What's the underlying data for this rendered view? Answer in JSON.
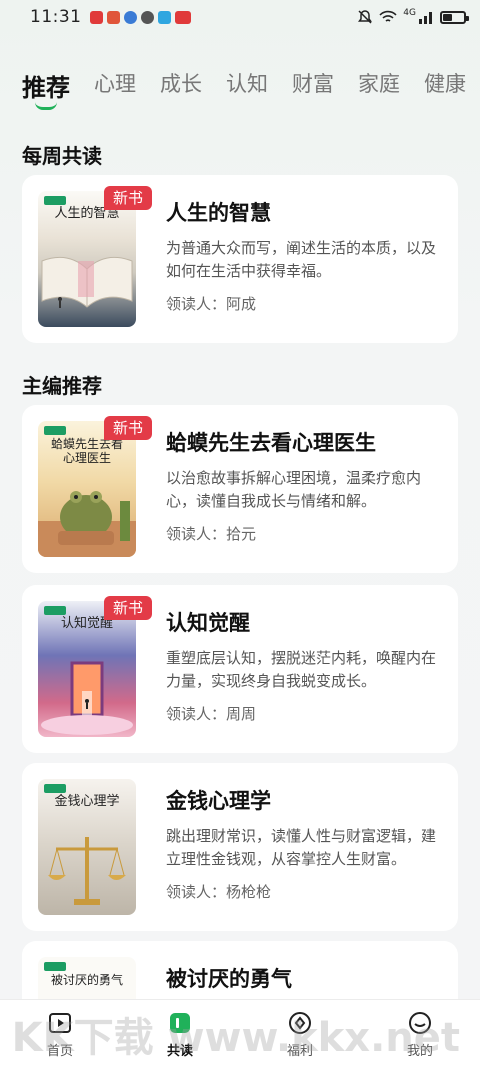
{
  "status_bar": {
    "time": "11:31",
    "network": "4G",
    "colors": [
      "#e03a3a",
      "#e0553a",
      "#3a7bd5",
      "#3a6fd5",
      "#2fa6e0",
      "#e03a3a"
    ]
  },
  "tabs": [
    {
      "label": "推荐",
      "active": true
    },
    {
      "label": "心理"
    },
    {
      "label": "成长"
    },
    {
      "label": "认知"
    },
    {
      "label": "财富"
    },
    {
      "label": "家庭"
    },
    {
      "label": "健康"
    }
  ],
  "sections": {
    "weekly": "每周共读",
    "editor": "主编推荐"
  },
  "books": [
    {
      "cover_title": "人生的智慧",
      "badge": "新书",
      "title": "人生的智慧",
      "desc": "为普通大众而写，阐述生活的本质，以及如何在生活中获得幸福。",
      "reader_label": "领读人：",
      "reader": "阿成"
    },
    {
      "cover_title": "蛤蟆先生去看心理医生",
      "badge": "新书",
      "title": "蛤蟆先生去看心理医生",
      "desc": "以治愈故事拆解心理困境，温柔疗愈内心，读懂自我成长与情绪和解。",
      "reader_label": "领读人：",
      "reader": "拾元"
    },
    {
      "cover_title": "认知觉醒",
      "badge": "新书",
      "title": "认知觉醒",
      "desc": "重塑底层认知，摆脱迷茫内耗，唤醒内在力量，实现终身自我蜕变成长。",
      "reader_label": "领读人：",
      "reader": "周周"
    },
    {
      "cover_title": "金钱心理学",
      "title": "金钱心理学",
      "desc": "跳出理财常识，读懂人性与财富逻辑，建立理性金钱观，从容掌控人生财富。",
      "reader_label": "领读人：",
      "reader": "杨枪枪"
    },
    {
      "cover_title": "被讨厌的勇气",
      "title": "被讨厌的勇气"
    }
  ],
  "bottom_nav": [
    {
      "label": "首页",
      "icon": "home-play-icon"
    },
    {
      "label": "共读",
      "icon": "book-icon",
      "active": true
    },
    {
      "label": "福利",
      "icon": "gift-circle-icon"
    },
    {
      "label": "我的",
      "icon": "profile-icon"
    }
  ],
  "watermark": "KK下载 www.kkx.net",
  "accent": "#20b15a",
  "badge_color": "#e33b47"
}
